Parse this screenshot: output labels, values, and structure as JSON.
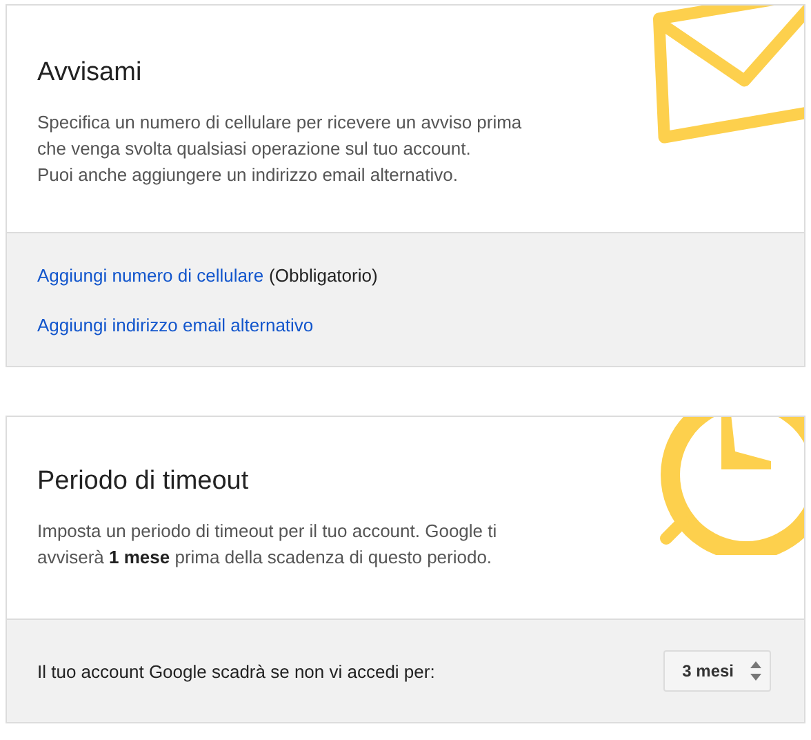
{
  "sections": [
    {
      "kind": "notify",
      "title": "Avvisami",
      "description": [
        "Specifica un numero di cellulare per ricevere un avviso prima",
        "che venga svolta qualsiasi operazione sul tuo account.",
        "Puoi anche aggiungere un indirizzo email alternativo."
      ],
      "links": [
        {
          "label": "Aggiungi numero di cellulare",
          "note": "(Obbligatorio)"
        },
        {
          "label": "Aggiungi indirizzo email alternativo"
        }
      ]
    },
    {
      "kind": "timeout",
      "title": "Periodo di timeout",
      "description": [
        "Imposta un periodo di timeout per il tuo account. Google ti",
        "avviserà **1 mese** prima della scadenza di questo periodo."
      ],
      "setting": {
        "label": "Il tuo account Google scadrà se non vi accedi per:",
        "value": "3 mesi"
      }
    }
  ]
}
